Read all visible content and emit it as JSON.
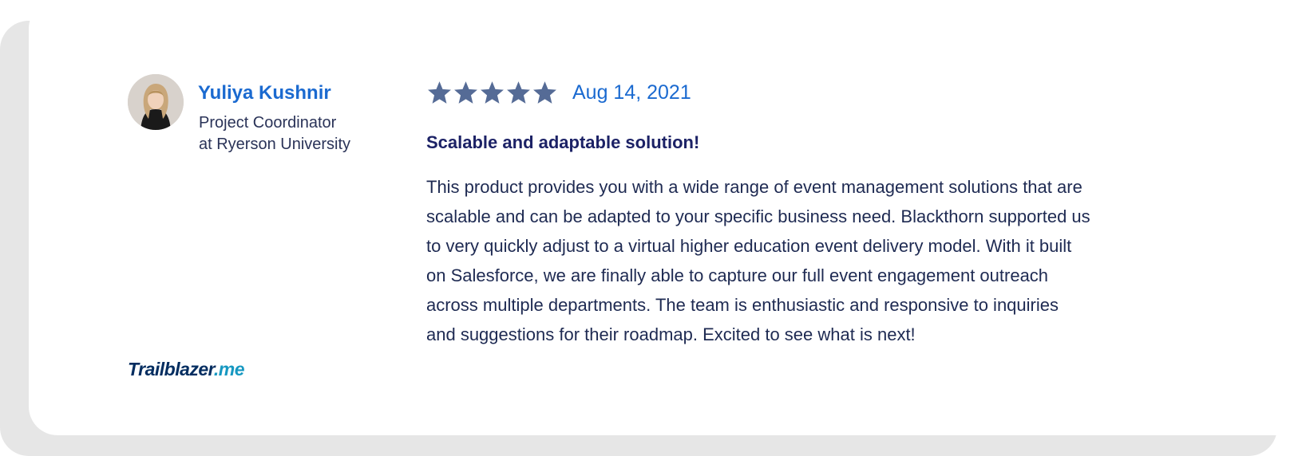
{
  "reviewer": {
    "name": "Yuliya Kushnir",
    "role_line1": "Project Coordinator",
    "role_line2": "at Ryerson University"
  },
  "review": {
    "rating": 5,
    "rating_max": 5,
    "date": "Aug 14, 2021",
    "title": "Scalable and adaptable solution!",
    "body_lines": [
      "This product provides you with a wide range of event management solutions that are",
      "scalable and can be adapted to your specific business need. Blackthorn supported us",
      "to very quickly adjust to a virtual higher education event delivery model. With it built",
      "on Salesforce, we are finally able to capture our full event engagement outreach",
      "across multiple departments. The team is enthusiastic and responsive to inquiries",
      "and suggestions for their roadmap. Excited to see what is next!"
    ]
  },
  "footer": {
    "logo_brand": "Trailblazer",
    "logo_tld": ".me"
  },
  "icons": {
    "star": "star-icon",
    "avatar": "avatar-photo"
  },
  "colors": {
    "accent_blue": "#1b6ad0",
    "star_fill": "#556b96",
    "title_navy": "#1c2266",
    "body_text": "#1e2a52",
    "card_shadow": "#e6e6e6"
  }
}
